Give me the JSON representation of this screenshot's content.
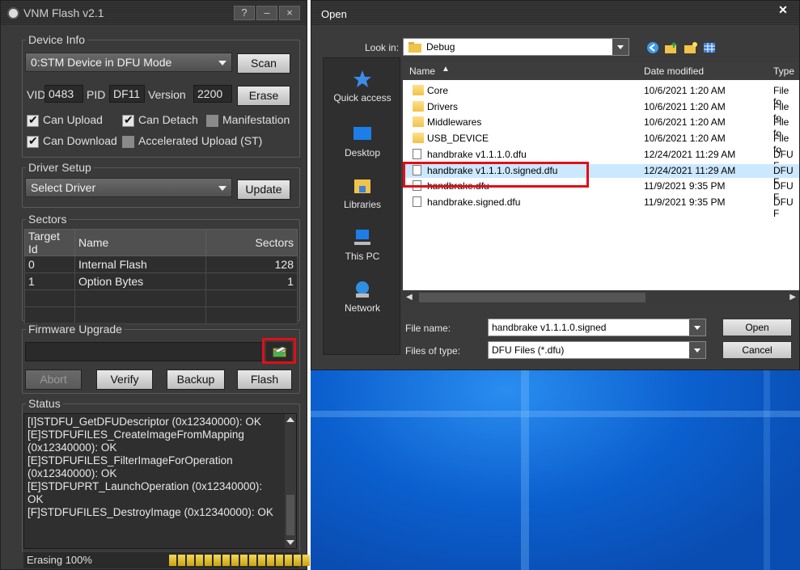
{
  "vnm": {
    "title": "VNM Flash v2.1",
    "titlebar_buttons": [
      "?",
      "–",
      "×"
    ],
    "device_info": {
      "legend": "Device Info",
      "device_select": "0:STM Device in DFU Mode",
      "scan_label": "Scan",
      "vid_label": "VID",
      "vid_value": "0483",
      "pid_label": "PID",
      "pid_value": "DF11",
      "version_label": "Version",
      "version_value": "2200",
      "erase_label": "Erase",
      "can_upload": "Can Upload",
      "can_detach": "Can Detach",
      "manifestation": "Manifestation",
      "can_download": "Can Download",
      "accelerated_upload": "Accelerated Upload (ST)"
    },
    "driver_setup": {
      "legend": "Driver Setup",
      "driver_select": "Select Driver",
      "update_label": "Update"
    },
    "sectors": {
      "legend": "Sectors",
      "columns": [
        "Target Id",
        "Name",
        "Sectors"
      ],
      "rows": [
        [
          "0",
          "Internal Flash",
          "128"
        ],
        [
          "1",
          "Option Bytes",
          "1"
        ]
      ]
    },
    "firmware": {
      "legend": "Firmware Upgrade",
      "path": "",
      "abort_label": "Abort",
      "verify_label": "Verify",
      "backup_label": "Backup",
      "flash_label": "Flash"
    },
    "status": {
      "legend": "Status",
      "lines": [
        "[I]STDFU_GetDFUDescriptor (0x12340000): OK",
        "[E]STDFUFILES_CreateImageFromMapping",
        "(0x12340000): OK",
        "[E]STDFUFILES_FilterImageForOperation",
        "(0x12340000): OK",
        "[E]STDFUPRT_LaunchOperation (0x12340000):",
        "OK",
        "[F]STDFUFILES_DestroyImage (0x12340000): OK"
      ],
      "progress_text": "Erasing 100%",
      "progress_fraction": 1.0
    }
  },
  "dialog": {
    "title": "Open",
    "look_in_label": "Look in:",
    "look_in_value": "Debug",
    "places": [
      "Quick access",
      "Desktop",
      "Libraries",
      "This PC",
      "Network"
    ],
    "columns": {
      "name": "Name",
      "date": "Date modified",
      "type": "Type"
    },
    "files": [
      {
        "name": "Core",
        "date": "10/6/2021 1:20 AM",
        "type": "File fo",
        "kind": "folder"
      },
      {
        "name": "Drivers",
        "date": "10/6/2021 1:20 AM",
        "type": "File fo",
        "kind": "folder"
      },
      {
        "name": "Middlewares",
        "date": "10/6/2021 1:20 AM",
        "type": "File fo",
        "kind": "folder"
      },
      {
        "name": "USB_DEVICE",
        "date": "10/6/2021 1:20 AM",
        "type": "File fo",
        "kind": "folder"
      },
      {
        "name": "handbrake v1.1.1.0.dfu",
        "date": "12/24/2021 11:29 AM",
        "type": "DFU F",
        "kind": "file"
      },
      {
        "name": "handbrake v1.1.1.0.signed.dfu",
        "date": "12/24/2021 11:29 AM",
        "type": "DFU F",
        "kind": "file",
        "selected": true
      },
      {
        "name": "handbrake.dfu",
        "date": "11/9/2021 9:35 PM",
        "type": "DFU F",
        "kind": "file"
      },
      {
        "name": "handbrake.signed.dfu",
        "date": "11/9/2021 9:35 PM",
        "type": "DFU F",
        "kind": "file"
      }
    ],
    "file_name_label": "File name:",
    "file_name_value": "handbrake v1.1.1.0.signed",
    "file_type_label": "Files of type:",
    "file_type_value": "DFU Files (*.dfu)",
    "open_label": "Open",
    "cancel_label": "Cancel"
  },
  "colors": {
    "highlight": "#e10e17",
    "selection": "#cce8ff",
    "progress": "#e8c22a"
  }
}
